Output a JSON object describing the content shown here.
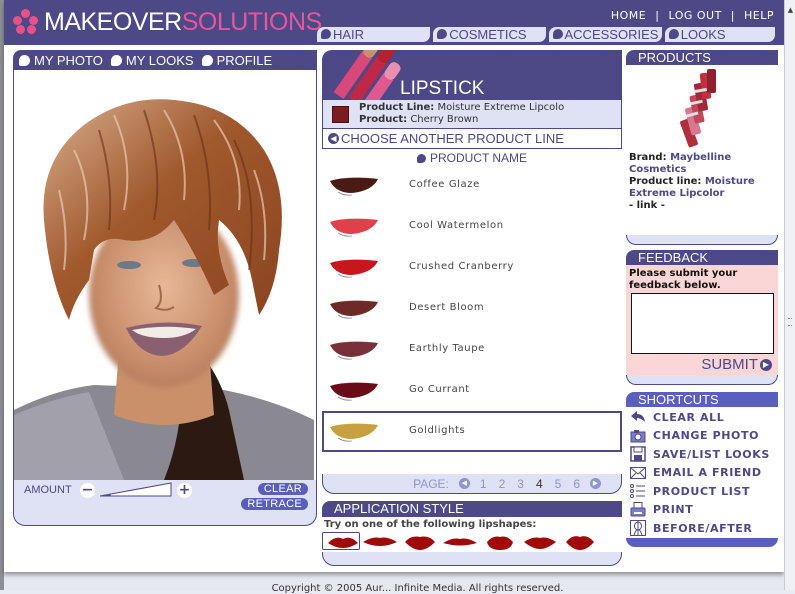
{
  "brand": {
    "word1": "MAKEOVER",
    "word2": "SOLUTIONS"
  },
  "top_links": [
    "HOME",
    "|",
    "LOG OUT",
    "|",
    "HELP"
  ],
  "nav_tabs": [
    "HAIR",
    "COSMETICS",
    "ACCESSORIES",
    "LOOKS"
  ],
  "left_panel": {
    "tabs": [
      "MY PHOTO",
      "MY LOOKS",
      "PROFILE"
    ],
    "amount_label": "AMOUNT",
    "amount_level_percent": 15,
    "clear_label": "CLEAR",
    "retrace_label": "RETRACE"
  },
  "lipstick": {
    "title": "LIPSTICK",
    "product_line_label": "Product Line:",
    "product_line_value": "Moisture Extreme Lipcolo",
    "product_label": "Product:",
    "product_value": "Cherry Brown",
    "swatch_color": "#7a1c20",
    "choose_another": "CHOOSE ANOTHER PRODUCT LINE",
    "product_name_header": "PRODUCT NAME",
    "products": [
      {
        "name": "Coffee Glaze",
        "color": "#4a1a14",
        "selected": false
      },
      {
        "name": "Cool Watermelon",
        "color": "#e0404a",
        "selected": false
      },
      {
        "name": "Crushed Cranberry",
        "color": "#c8161e",
        "selected": false
      },
      {
        "name": "Desert Bloom",
        "color": "#6e2a24",
        "selected": false
      },
      {
        "name": "Earthly Taupe",
        "color": "#7a3038",
        "selected": false
      },
      {
        "name": "Go Currant",
        "color": "#6a0c18",
        "selected": false
      },
      {
        "name": "Goldlights",
        "color": "#c8a040",
        "selected": true
      }
    ],
    "pager": {
      "label": "PAGE:",
      "pages": [
        "1",
        "2",
        "3",
        "4",
        "5",
        "6"
      ],
      "current": "4"
    }
  },
  "application_style": {
    "title": "APPLICATION STYLE",
    "hint": "Try on one of the following lipshapes:",
    "lipshape_count": 7,
    "selected_index": 0,
    "lip_color": "#a00a0a"
  },
  "products_panel": {
    "title": "PRODUCTS",
    "brand_label": "Brand:",
    "brand_value": "Maybelline Cosmetics",
    "line_label": "Product line:",
    "line_value": "Moisture Extreme Lipcolor",
    "link_text": "- link -"
  },
  "feedback": {
    "title": "FEEDBACK",
    "hint": "Please submit your feedback below.",
    "value": "",
    "submit_label": "SUBMIT"
  },
  "shortcuts": {
    "title": "SHORTCUTS",
    "items": [
      {
        "label": "CLEAR ALL",
        "icon": "undo-arrow-icon"
      },
      {
        "label": "CHANGE PHOTO",
        "icon": "camera-icon"
      },
      {
        "label": "SAVE/LIST LOOKS",
        "icon": "floppy-disk-icon"
      },
      {
        "label": "EMAIL A FRIEND",
        "icon": "envelope-icon"
      },
      {
        "label": "PRODUCT LIST",
        "icon": "list-icon"
      },
      {
        "label": "PRINT",
        "icon": "printer-icon"
      },
      {
        "label": "BEFORE/AFTER",
        "icon": "before-after-icon"
      }
    ]
  },
  "footer": "Copyright © 2005 Aur... Infinite Media. All rights reserved."
}
